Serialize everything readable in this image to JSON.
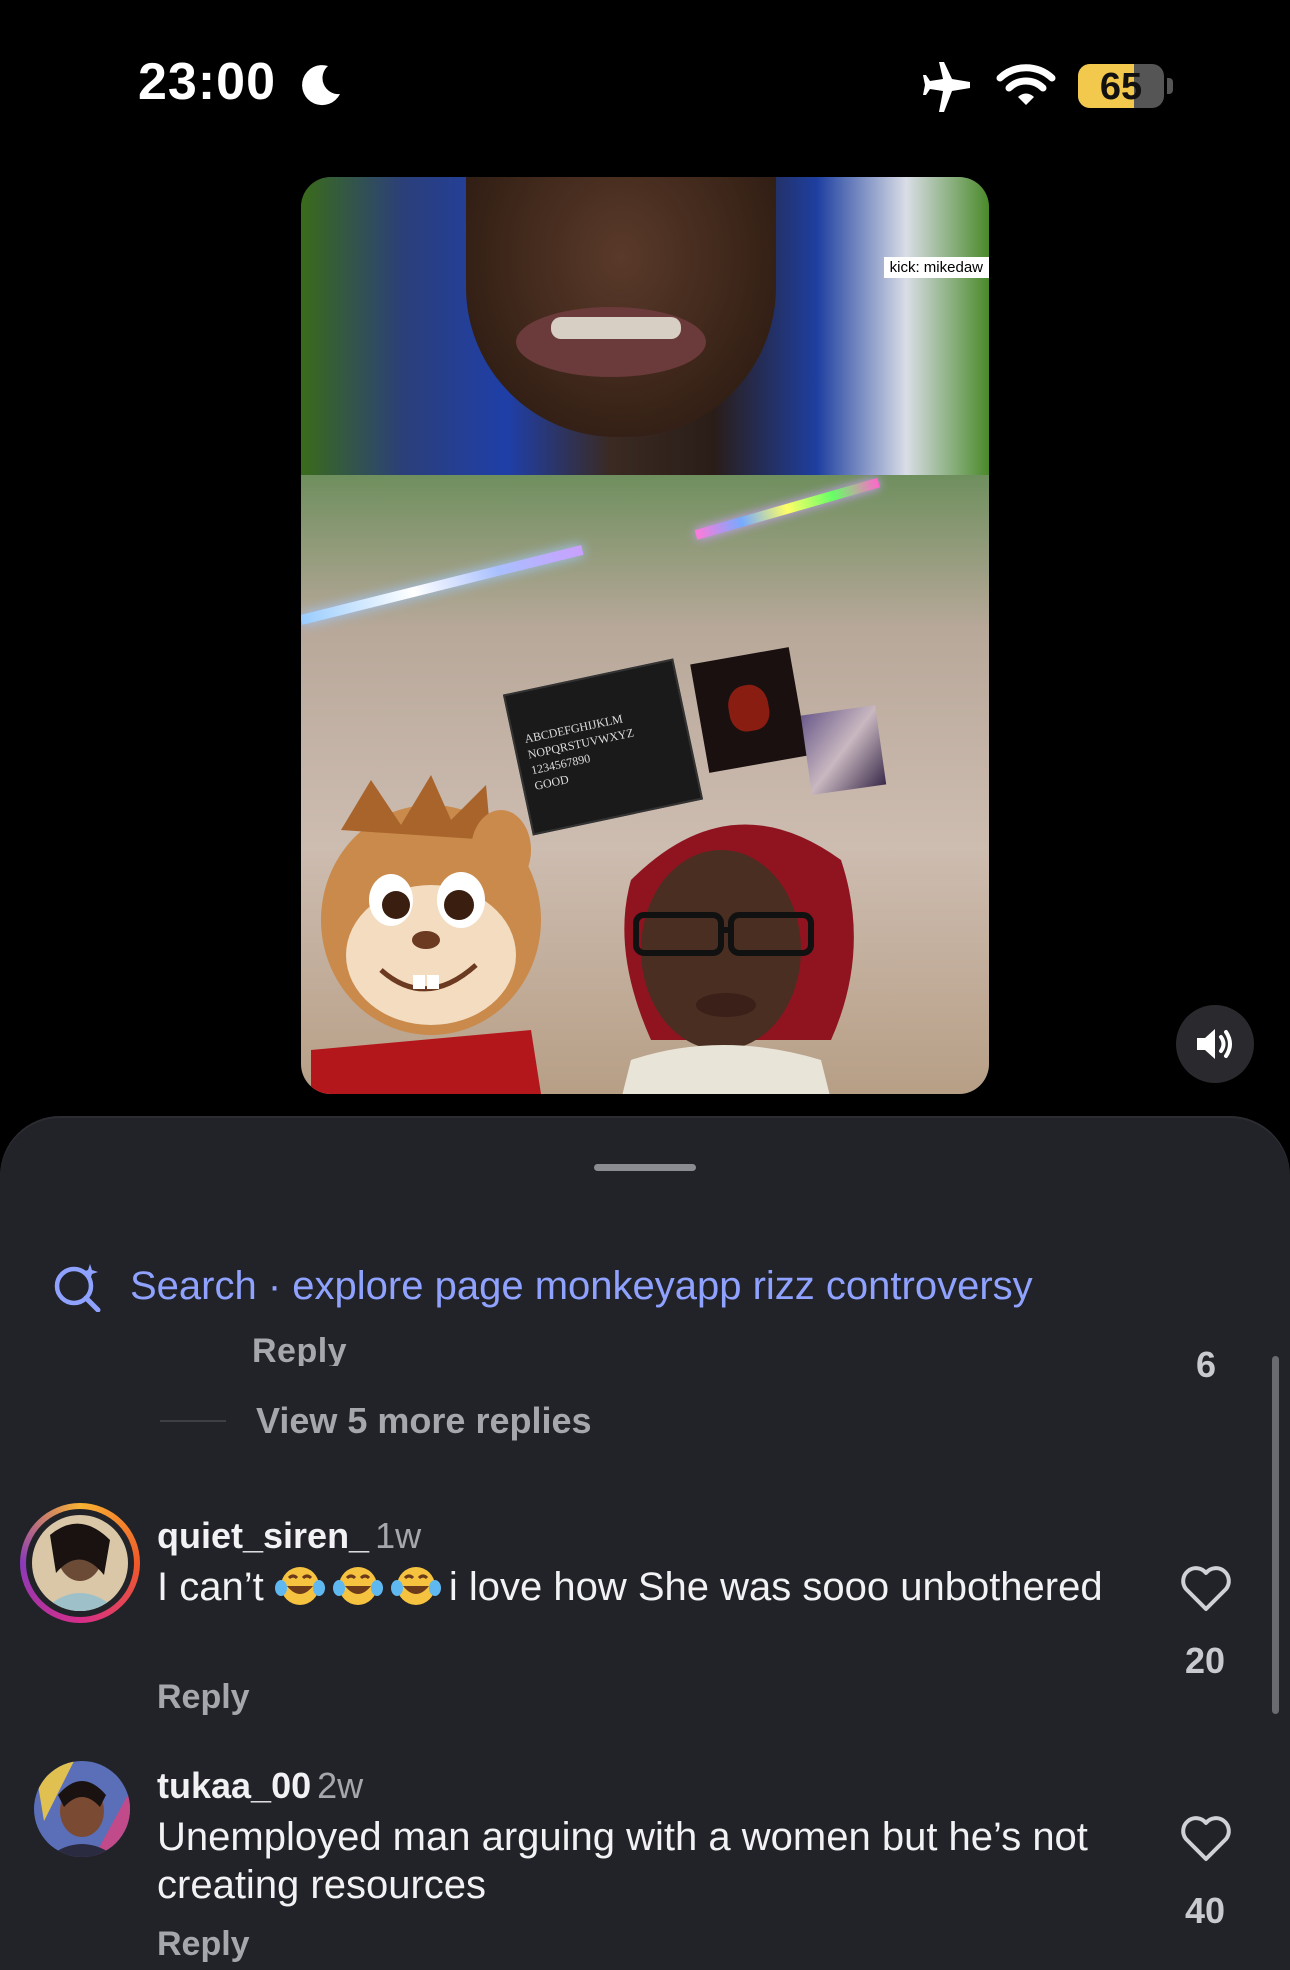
{
  "status_bar": {
    "time": "23:00",
    "battery": "65",
    "battery_level": 0.65
  },
  "video": {
    "overlay_label": "kick: mikedaw",
    "board_text": [
      "ABCDEFGHIJKLM",
      "NOPQRSTUVWXYZ",
      "1234567890",
      "GOOD"
    ]
  },
  "sheet": {
    "search_label": "Search · explore page monkeyapp rizz controversy",
    "previous_thread": {
      "reply_label": "Reply",
      "like_count": "6",
      "view_more": "View 5 more replies"
    },
    "comments": [
      {
        "username": "quiet_siren_",
        "age": "1w",
        "text_before_emoji": "I can’t",
        "emojis": [
          "😂",
          "😂",
          "😂"
        ],
        "text_after_emoji": "i love how She was sooo unbothered",
        "reply_label": "Reply",
        "like_count": "20"
      },
      {
        "username": "tukaa_00",
        "age": "2w",
        "text": "Unemployed man arguing with a women but he’s not creating resources",
        "reply_label": "Reply",
        "like_count": "40"
      }
    ]
  },
  "icons": {
    "status": [
      "moon-icon",
      "airplane-icon",
      "wifi-icon",
      "battery-icon"
    ],
    "video": [
      "speaker-icon"
    ],
    "sheet": [
      "search-sparkle-icon",
      "heart-icon"
    ]
  },
  "colors": {
    "sheet_background": "#222328",
    "search_accent": "#8fa2ff",
    "battery_fill": "#f2c94c"
  }
}
